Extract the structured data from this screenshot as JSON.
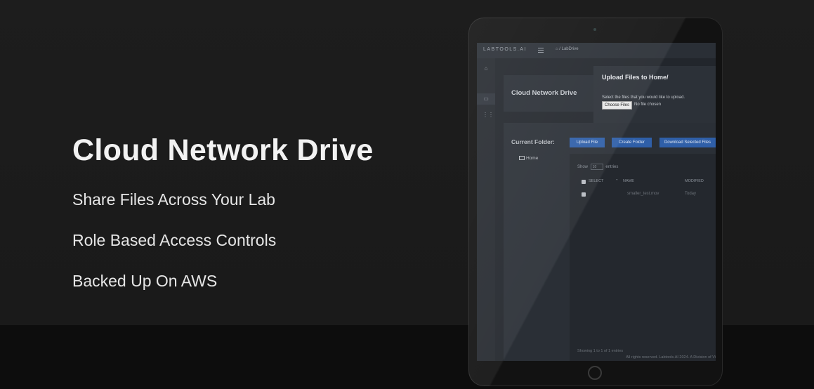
{
  "hero": {
    "title": "Cloud Network Drive",
    "features": [
      "Share Files Across Your Lab",
      "Role Based Access Controls",
      "Backed Up On AWS"
    ]
  },
  "app": {
    "logo": "LABTOOLS.AI",
    "breadcrumb": "/ LabDrive",
    "sidebar_icons": [
      "home-icon",
      "folder-icon",
      "grid-icon"
    ],
    "card_title": "Cloud Network Drive",
    "modal": {
      "title": "Upload Files to Home/",
      "instruction": "Select the files that you would like to upload.",
      "choose_label": "Choose Files",
      "no_file": "No file chosen"
    },
    "current_folder_label": "Current Folder:",
    "folder_home": "Home",
    "buttons": {
      "upload": "Upload File",
      "create_folder": "Create Folder",
      "download": "Download Selected Files"
    },
    "table": {
      "show_prefix": "Show",
      "show_value": "10",
      "show_suffix": "entries",
      "columns": [
        "SELECT",
        "NAME",
        "MODIFIED"
      ],
      "rows": [
        {
          "name": "smaller_test.mov",
          "modified": "Today"
        }
      ],
      "showing_text": "Showing 1 to 1 of 1 entries"
    },
    "footer": "All rights reserved. Labtools.AI 2024. A Division of Vi"
  },
  "colors": {
    "accent": "#2f5fa8",
    "background": "#1c1c1c",
    "panel": "#2a2f36"
  }
}
